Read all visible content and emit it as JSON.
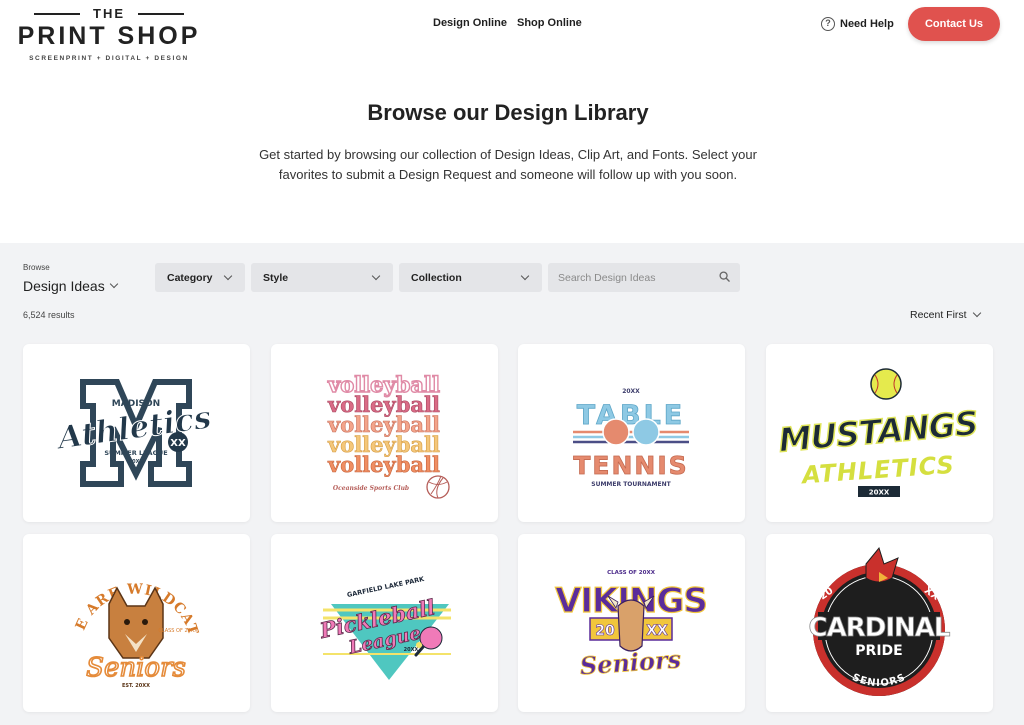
{
  "header": {
    "logo": {
      "the": "THE",
      "main": "PRINT SHOP",
      "tagline": "SCREENPRINT + DIGITAL + DESIGN"
    },
    "nav": [
      {
        "label": "Design Online"
      },
      {
        "label": "Shop Online"
      }
    ],
    "help": {
      "icon": "question-circle-icon",
      "label": "Need Help"
    },
    "contact": {
      "label": "Contact Us",
      "color": "#e0524e"
    }
  },
  "hero": {
    "title": "Browse our Design Library",
    "subtitle": "Get started by browsing our collection of Design Ideas, Clip Art, and Fonts. Select your favorites to submit a Design Request and someone will follow up with you soon."
  },
  "catalog": {
    "browse_label": "Browse",
    "browse_value": "Design Ideas",
    "results": "6,524 results",
    "filters": [
      {
        "label": "Category"
      },
      {
        "label": "Style"
      },
      {
        "label": "Collection"
      }
    ],
    "search": {
      "placeholder": "Search Design Ideas",
      "icon": "search-icon"
    },
    "sort": {
      "label": "Recent First"
    },
    "designs": [
      {
        "name": "madison-athletics",
        "texts": [
          "MADISON",
          "Athletics",
          "XX",
          "SUMMER LEAGUE",
          "20XX"
        ]
      },
      {
        "name": "volleyball",
        "texts": [
          "volleyball",
          "Oceanside Sports Club"
        ]
      },
      {
        "name": "table-tennis",
        "texts": [
          "20XX",
          "TABLE",
          "TENNIS",
          "SUMMER TOURNAMENT"
        ]
      },
      {
        "name": "mustangs-athletics",
        "texts": [
          "MUSTANGS",
          "ATHLETICS",
          "20XX"
        ]
      },
      {
        "name": "wildcats-seniors",
        "texts": [
          "WE ARE WILDCATS",
          "CLASS OF 20XX",
          "Seniors",
          "EST. 20XX"
        ]
      },
      {
        "name": "pickleball-league",
        "texts": [
          "GARFIELD LAKE PARK",
          "Pickleball",
          "League",
          "20XX"
        ]
      },
      {
        "name": "vikings-seniors",
        "texts": [
          "CLASS OF 20XX",
          "VIKINGS",
          "20",
          "XX",
          "Seniors"
        ]
      },
      {
        "name": "cardinal-pride",
        "texts": [
          "20",
          "XX",
          "CARDINAL",
          "PRIDE",
          "SENIORS"
        ]
      }
    ]
  },
  "colors": {
    "accent": "#e0524e",
    "catalog_bg": "#f2f3f5",
    "filter_bg": "#e4e5e8"
  }
}
